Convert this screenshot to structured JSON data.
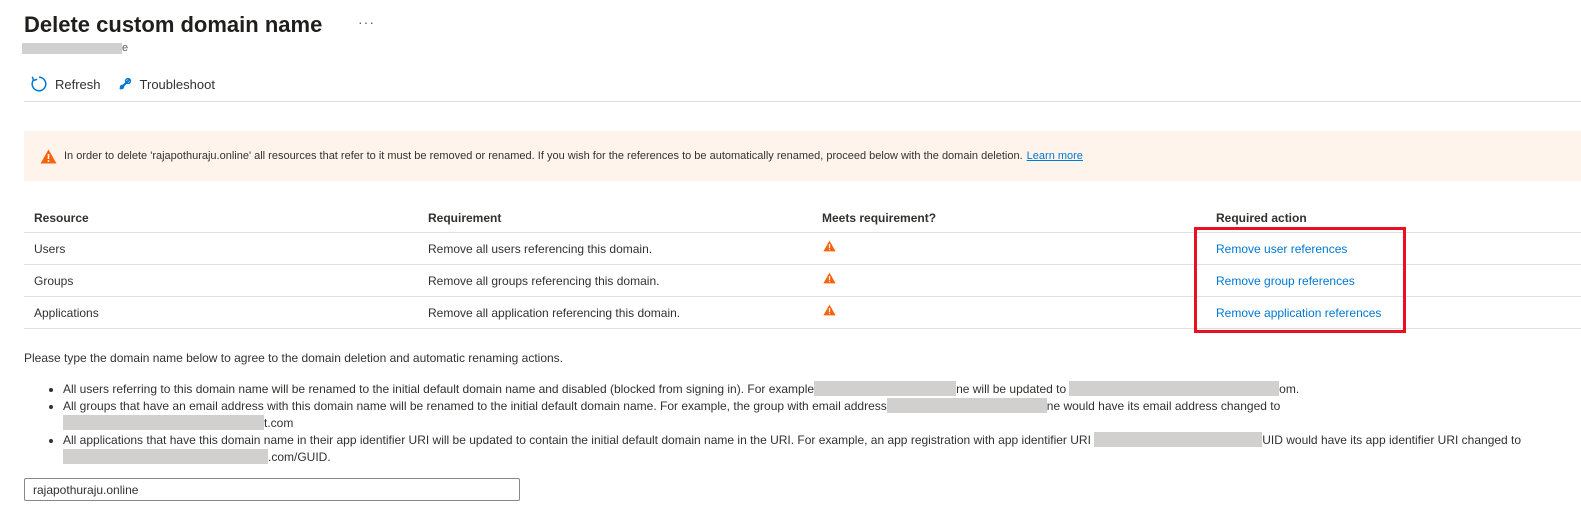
{
  "header": {
    "title": "Delete custom domain name",
    "more_label": "···",
    "subtitle_visible_tail": "e"
  },
  "toolbar": {
    "refresh_label": "Refresh",
    "troubleshoot_label": "Troubleshoot",
    "refresh_icon": "refresh-icon",
    "troubleshoot_icon": "wrench-icon"
  },
  "banner": {
    "icon": "warning-icon",
    "text": "In order to delete 'rajapothuraju.online' all resources that refer to it must be removed or renamed. If you wish for the references to be automatically renamed, proceed below with the domain deletion.",
    "link": "Learn more"
  },
  "table": {
    "headers": [
      "Resource",
      "Requirement",
      "Meets requirement?",
      "Required action"
    ],
    "rows": [
      {
        "resource": "Users",
        "requirement": "Remove all users referencing this domain.",
        "meets_icon": "warning-icon",
        "action": "Remove user references"
      },
      {
        "resource": "Groups",
        "requirement": "Remove all groups referencing this domain.",
        "meets_icon": "warning-icon",
        "action": "Remove group references"
      },
      {
        "resource": "Applications",
        "requirement": "Remove all application referencing this domain.",
        "meets_icon": "warning-icon",
        "action": "Remove application references"
      }
    ]
  },
  "instructions": "Please type the domain name below to agree to the domain deletion and automatic renaming actions.",
  "bullets": {
    "b1_p1": "All users referring to this domain name will be renamed to the initial default domain name and disabled (blocked from signing in). For example",
    "b1_p2": "ne will be updated to",
    "b1_p3": "om.",
    "b2_p1": "All groups that have an email address with this domain name will be renamed to the initial default domain name. For example, the group with email address",
    "b2_p2": "ne would have its email address changed to",
    "b2_p3": "t.com",
    "b3_p1": "All applications that have this domain name in their app identifier URI will be updated to contain the initial default domain name in the URI. For example, an app registration with app identifier URI",
    "b3_p2": "UID would have its app identifier URI changed to",
    "b3_p3": ".com/GUID."
  },
  "domain_input": {
    "value": "rajapothuraju.online"
  },
  "colors": {
    "link": "#0078d4",
    "warning": "#f7630c",
    "highlight_border": "#e81123",
    "banner_bg": "#fff4ec"
  }
}
